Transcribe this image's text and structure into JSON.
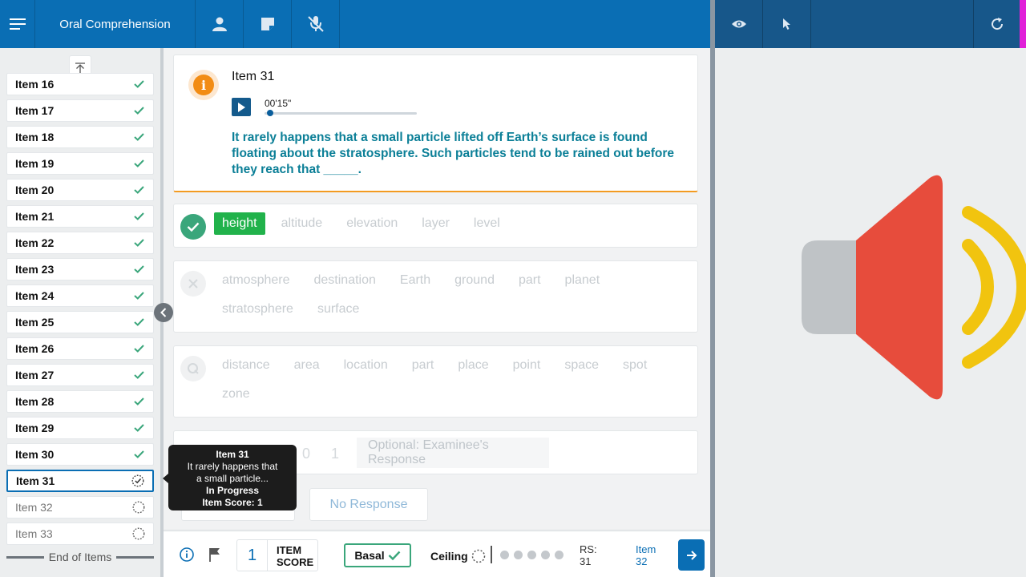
{
  "header": {
    "title": "Oral Comprehension"
  },
  "sidebar": {
    "items": [
      {
        "label": "Item 16",
        "status": "complete"
      },
      {
        "label": "Item 17",
        "status": "complete"
      },
      {
        "label": "Item 18",
        "status": "complete"
      },
      {
        "label": "Item 19",
        "status": "complete"
      },
      {
        "label": "Item 20",
        "status": "complete"
      },
      {
        "label": "Item 21",
        "status": "complete"
      },
      {
        "label": "Item 22",
        "status": "complete"
      },
      {
        "label": "Item 23",
        "status": "complete"
      },
      {
        "label": "Item 24",
        "status": "complete"
      },
      {
        "label": "Item 25",
        "status": "complete"
      },
      {
        "label": "Item 26",
        "status": "complete"
      },
      {
        "label": "Item 27",
        "status": "complete"
      },
      {
        "label": "Item 28",
        "status": "complete"
      },
      {
        "label": "Item 29",
        "status": "complete"
      },
      {
        "label": "Item 30",
        "status": "complete"
      },
      {
        "label": "Item 31",
        "status": "in-progress"
      },
      {
        "label": "Item 32",
        "status": "pending"
      },
      {
        "label": "Item 33",
        "status": "pending"
      }
    ],
    "end_label": "End of Items"
  },
  "item": {
    "title": "Item 31",
    "audio_time": "00'15\"",
    "audio_progress": 0.02,
    "prompt": "It rarely happens that a small particle lifted off Earth’s surface is found floating about the stratosphere. Such particles tend to be rained out before they reach that _____."
  },
  "responses": {
    "correct": [
      "height",
      "altitude",
      "elevation",
      "layer",
      "level"
    ],
    "correct_selected": "height",
    "incorrect": [
      "atmosphere",
      "destination",
      "Earth",
      "ground",
      "part",
      "planet",
      "stratosphere",
      "surface"
    ],
    "query": [
      "distance",
      "area",
      "location",
      "part",
      "place",
      "point",
      "space",
      "spot",
      "zone"
    ],
    "optional_score_0": "0",
    "optional_score_1": "1",
    "optional_placeholder": "Optional: Examinee's Response",
    "no_response_label": "No Response"
  },
  "tooltip": {
    "title": "Item 31",
    "line1": "It rarely happens that",
    "line2": "a small particle...",
    "status": "In Progress",
    "score": "Item Score: 1"
  },
  "footer": {
    "item_score": "1",
    "item_score_label_1": "ITEM",
    "item_score_label_2": "SCORE",
    "basal_label": "Basal",
    "ceiling_label": "Ceiling",
    "rs_label": "RS:",
    "rs_value": "31",
    "next_label": "Item",
    "next_value": "32"
  },
  "colors": {
    "header": "#0a6eb4",
    "header_right": "#17578a",
    "correct": "#3aa67b",
    "selected": "#21b24b",
    "prompt": "#0b7f97",
    "accent_orange": "#f28c14"
  },
  "icons": {
    "menu": "hamburger-icon",
    "person": "person-icon",
    "note": "note-icon",
    "mic_off": "mic-off-icon",
    "eye": "eye-icon",
    "cursor": "cursor-icon",
    "refresh": "refresh-icon",
    "speaker": "speaker-icon"
  }
}
